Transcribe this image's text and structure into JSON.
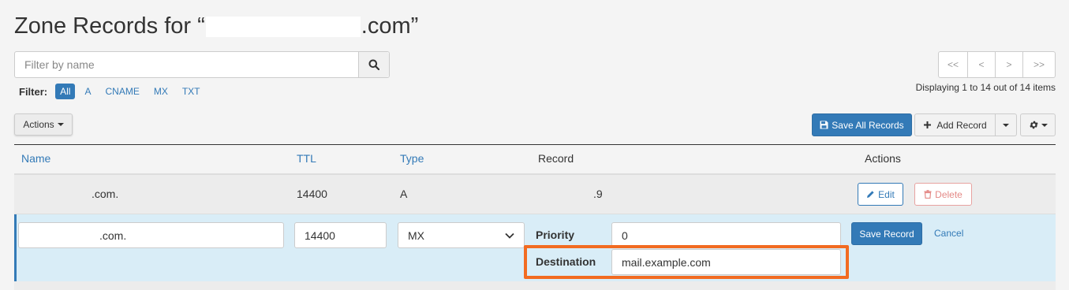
{
  "header": {
    "title_prefix": "Zone Records for “",
    "title_suffix": ".com”"
  },
  "search": {
    "placeholder": "Filter by name",
    "value": ""
  },
  "filter": {
    "label": "Filter:",
    "items": [
      "All",
      "A",
      "CNAME",
      "MX",
      "TXT"
    ],
    "active": "All"
  },
  "pagination": {
    "buttons": [
      "<<",
      "<",
      ">",
      ">>"
    ],
    "status": "Displaying 1 to 14 out of 14 items"
  },
  "toolbar": {
    "actions_label": "Actions",
    "save_all_label": "Save All Records",
    "add_record_label": "Add Record"
  },
  "table": {
    "headers": {
      "name": "Name",
      "ttl": "TTL",
      "type": "Type",
      "record": "Record",
      "actions": "Actions"
    },
    "row1": {
      "name": ".com.",
      "ttl": "14400",
      "type": "A",
      "record": ".9",
      "edit_label": "Edit",
      "delete_label": "Delete"
    },
    "edit_row": {
      "name_value": ".com.",
      "ttl_value": "14400",
      "type_value": "MX",
      "priority_label": "Priority",
      "priority_value": "0",
      "destination_label": "Destination",
      "destination_value": "mail.example.com",
      "save_label": "Save Record",
      "cancel_label": "Cancel"
    }
  },
  "colors": {
    "primary": "#337ab7",
    "edit_row_bg": "#d9edf7",
    "highlight": "#f26b21",
    "danger": "#e48a87"
  },
  "icons": [
    "search-icon",
    "save-icon",
    "plus-icon",
    "gear-icon",
    "pencil-icon",
    "trash-icon",
    "chevron-down-icon"
  ]
}
